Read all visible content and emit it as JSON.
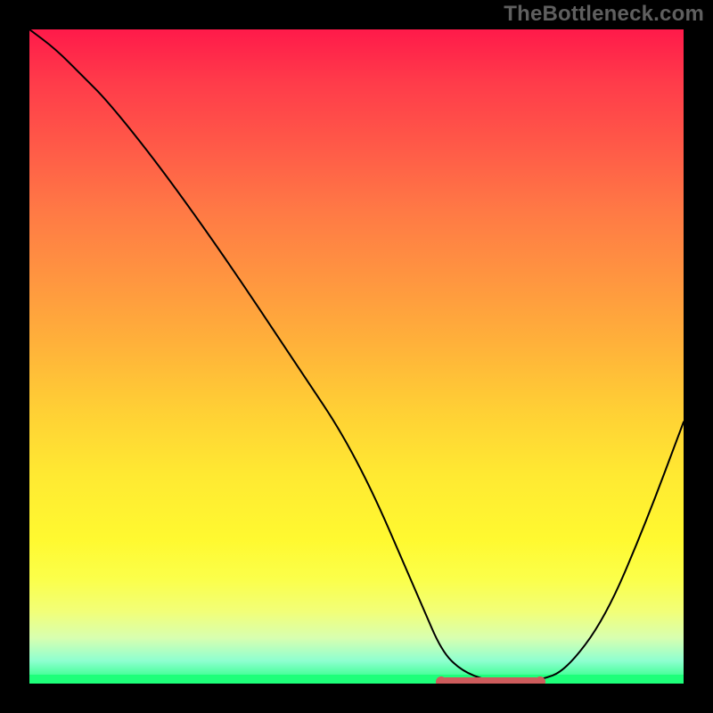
{
  "watermark": "TheBottleneck.com",
  "chart_data": {
    "type": "line",
    "title": "",
    "xlabel": "",
    "ylabel": "",
    "xlim": [
      0,
      100
    ],
    "ylim": [
      0,
      100
    ],
    "series": [
      {
        "name": "bottleneck-curve",
        "x": [
          0,
          4,
          8,
          12,
          20,
          30,
          40,
          50,
          60,
          63,
          66,
          70,
          74,
          78,
          82,
          88,
          94,
          100
        ],
        "y": [
          100,
          97,
          93,
          89,
          79,
          65,
          50,
          35,
          12,
          5,
          2,
          0.4,
          0.2,
          0.5,
          2,
          10,
          24,
          40
        ]
      }
    ],
    "minimum_region": {
      "x_start": 63,
      "x_end": 78,
      "y": 0.3
    },
    "gradient_colors": {
      "top": "#ff1a4a",
      "mid": "#ffe932",
      "bottom": "#1eff7a"
    },
    "curve_color": "#000000",
    "marker_color": "#cd5c5c"
  }
}
